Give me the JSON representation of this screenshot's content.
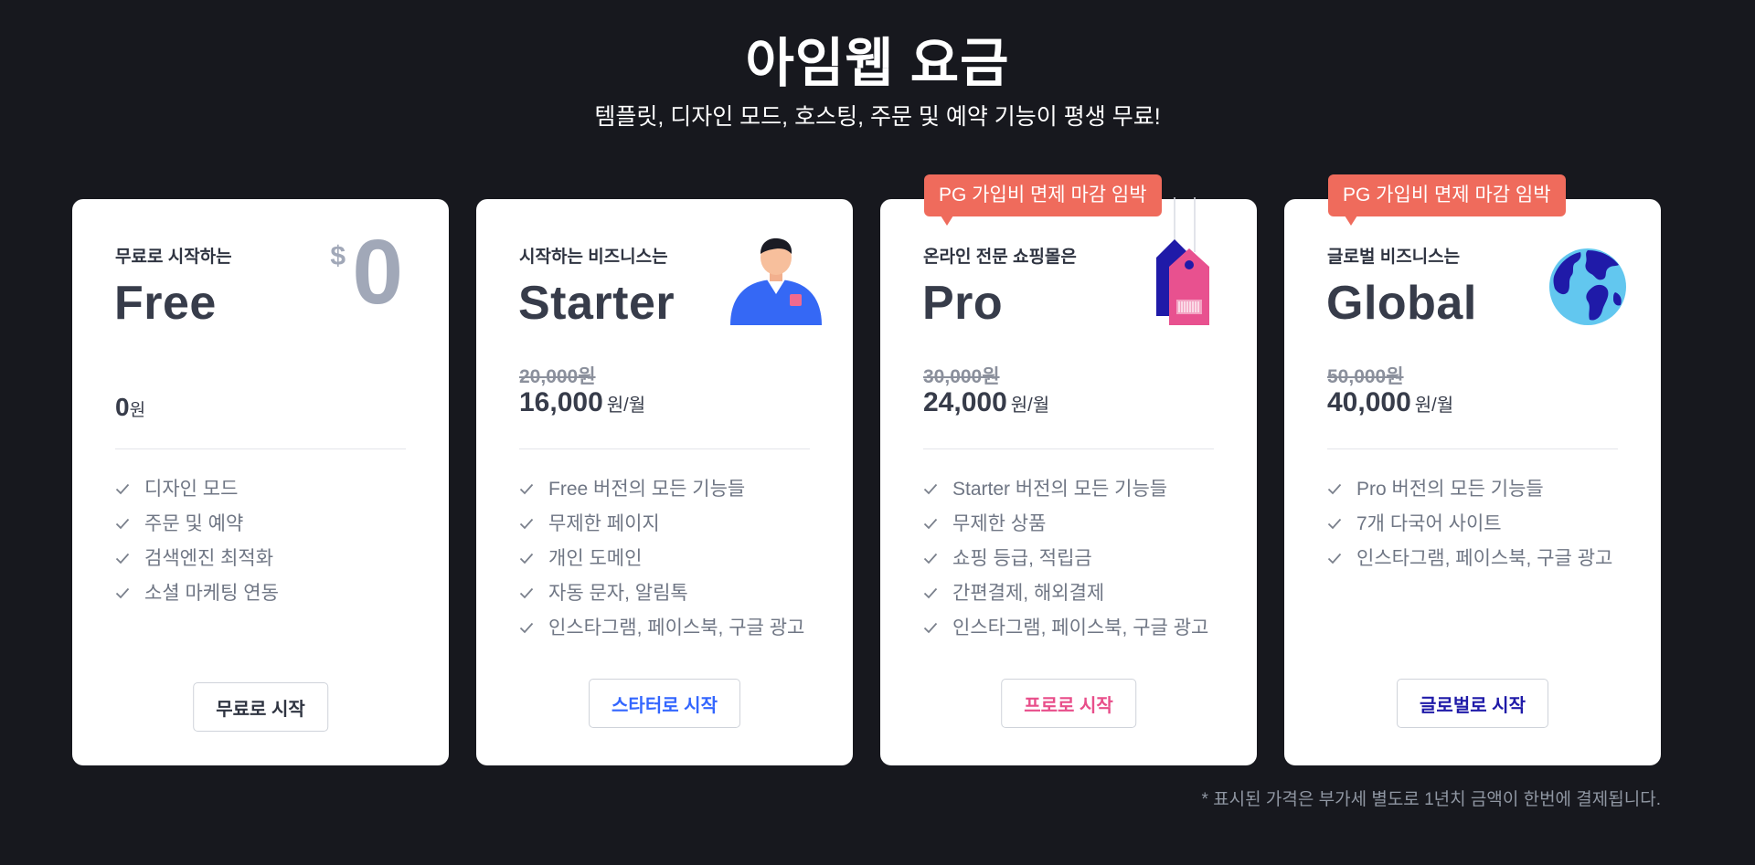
{
  "header": {
    "title": "아임웹 요금",
    "subtitle": "템플릿, 디자인 모드, 호스팅, 주문 및 예약 기능이 평생 무료!"
  },
  "colors": {
    "background": "#17181e",
    "badge": "#ef6b5c",
    "starter_accent": "#3366ff",
    "pro_accent": "#e84e8a",
    "global_accent": "#1f1aa8"
  },
  "plans": [
    {
      "eyebrow": "무료로 시작하는",
      "name": "Free",
      "badge": "",
      "illustration": "dollar-zero",
      "dollar_symbol": "$",
      "dollar_value": "0",
      "old_price": "",
      "price": "0",
      "price_unit": "원",
      "features": [
        "디자인 모드",
        "주문 및 예약",
        "검색엔진 최적화",
        "소셜 마케팅 연동"
      ],
      "cta": "무료로 시작",
      "cta_color": "#2f3441"
    },
    {
      "eyebrow": "시작하는 비즈니스는",
      "name": "Starter",
      "badge": "",
      "illustration": "person-icon",
      "old_price": "20,000원",
      "price": "16,000",
      "price_unit": "원/월",
      "features": [
        "Free 버전의 모든 기능들",
        "무제한 페이지",
        "개인 도메인",
        "자동 문자, 알림톡",
        "인스타그램, 페이스북, 구글 광고"
      ],
      "cta": "스타터로 시작",
      "cta_color": "#3366ff"
    },
    {
      "eyebrow": "온라인 전문 쇼핑몰은",
      "name": "Pro",
      "badge": "PG 가입비 면제 마감 임박",
      "illustration": "price-tag-icon",
      "old_price": "30,000원",
      "price": "24,000",
      "price_unit": "원/월",
      "features": [
        "Starter 버전의 모든 기능들",
        "무제한 상품",
        "쇼핑 등급, 적립금",
        "간편결제, 해외결제",
        "인스타그램, 페이스북, 구글 광고"
      ],
      "cta": "프로로 시작",
      "cta_color": "#e84e8a"
    },
    {
      "eyebrow": "글로벌 비즈니스는",
      "name": "Global",
      "badge": "PG 가입비 면제 마감 임박",
      "illustration": "globe-icon",
      "old_price": "50,000원",
      "price": "40,000",
      "price_unit": "원/월",
      "features": [
        "Pro 버전의 모든 기능들",
        "7개 다국어 사이트",
        "인스타그램, 페이스북, 구글 광고"
      ],
      "cta": "글로벌로 시작",
      "cta_color": "#1f1aa8"
    }
  ],
  "footnote": "* 표시된 가격은 부가세 별도로 1년치 금액이 한번에 결제됩니다."
}
